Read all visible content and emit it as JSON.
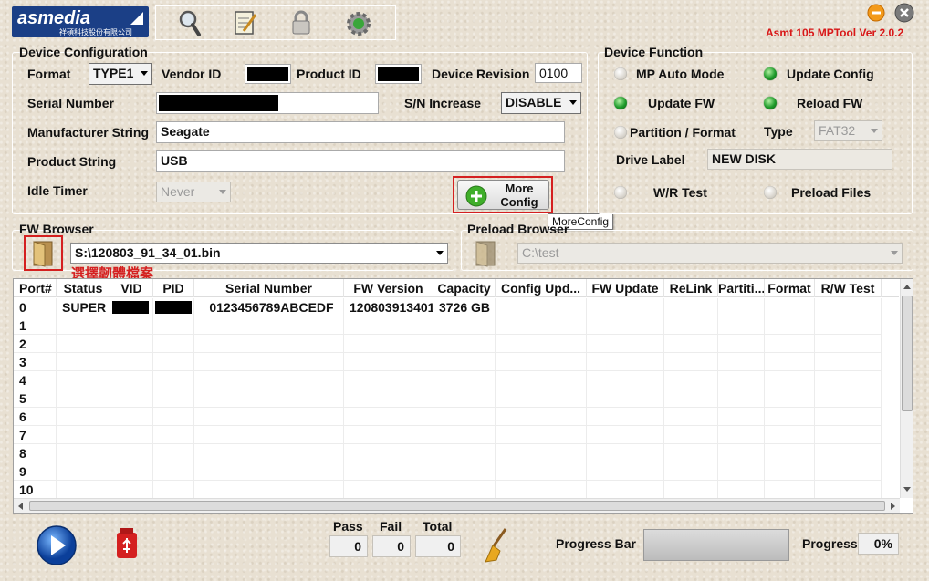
{
  "app": {
    "logo_text": "asmedia",
    "logo_subtext": "祥碩科技股份有限公司",
    "version_title": "Asmt 105 MPTool Ver 2.0.2",
    "toolbar_icons": [
      "search-icon",
      "notepad-icon",
      "lock-icon",
      "settings-gear-icon"
    ]
  },
  "device_config": {
    "title": "Device Configuration",
    "format_label": "Format",
    "format_value": "TYPE1",
    "vendor_id_label": "Vendor ID",
    "product_id_label": "Product ID",
    "device_revision_label": "Device Revision",
    "device_revision_value": "0100",
    "serial_number_label": "Serial Number",
    "sn_increase_label": "S/N Increase",
    "sn_increase_value": "DISABLE",
    "manufacturer_label": "Manufacturer String",
    "manufacturer_value": "Seagate",
    "product_string_label": "Product String",
    "product_string_value": "USB",
    "idle_timer_label": "Idle Timer",
    "idle_timer_value": "Never",
    "more_config_line1": "More",
    "more_config_line2": "Config",
    "more_config_tooltip": "MoreConfig"
  },
  "device_function": {
    "title": "Device Function",
    "mp_auto_mode": "MP Auto Mode",
    "update_config": "Update Config",
    "update_fw": "Update FW",
    "reload_fw": "Reload FW",
    "partition_format": "Partition / Format",
    "type_label": "Type",
    "type_value": "FAT32",
    "drive_label_label": "Drive Label",
    "drive_label_value": "NEW DISK",
    "wr_test": "W/R Test",
    "preload_files": "Preload Files",
    "leds": {
      "mp_auto_mode": false,
      "update_config": true,
      "update_fw": true,
      "reload_fw": true,
      "partition_format": false,
      "wr_test": false,
      "preload_files": false
    },
    "led_on_color": "#1e9a2a"
  },
  "fw_browser": {
    "title": "FW Browser",
    "path": "S:\\120803_91_34_01.bin",
    "annotation": "選擇韌體檔案"
  },
  "preload_browser": {
    "title": "Preload Browser",
    "path": "C:\\test"
  },
  "grid": {
    "columns": [
      "Port#",
      "Status",
      "VID",
      "PID",
      "Serial Number",
      "FW Version",
      "Capacity",
      "Config Upd...",
      "FW Update",
      "ReLink",
      "Partiti...",
      "Format",
      "R/W Test"
    ],
    "rows": [
      {
        "port": "0",
        "status": "SUPER",
        "serial": "0123456789ABCEDF",
        "fw": "120803913401",
        "capacity": "3726 GB"
      },
      {
        "port": "1"
      },
      {
        "port": "2"
      },
      {
        "port": "3"
      },
      {
        "port": "4"
      },
      {
        "port": "5"
      },
      {
        "port": "6"
      },
      {
        "port": "7"
      },
      {
        "port": "8"
      },
      {
        "port": "9"
      },
      {
        "port": "10"
      }
    ]
  },
  "bottom": {
    "pass_label": "Pass",
    "pass_value": "0",
    "fail_label": "Fail",
    "fail_value": "0",
    "total_label": "Total",
    "total_value": "0",
    "progress_bar_label": "Progress Bar",
    "progress_label": "Progress",
    "progress_value": "0%",
    "progress_fraction": 0
  },
  "colors": {
    "accent_red": "#d42020",
    "title_red": "#d81818"
  }
}
